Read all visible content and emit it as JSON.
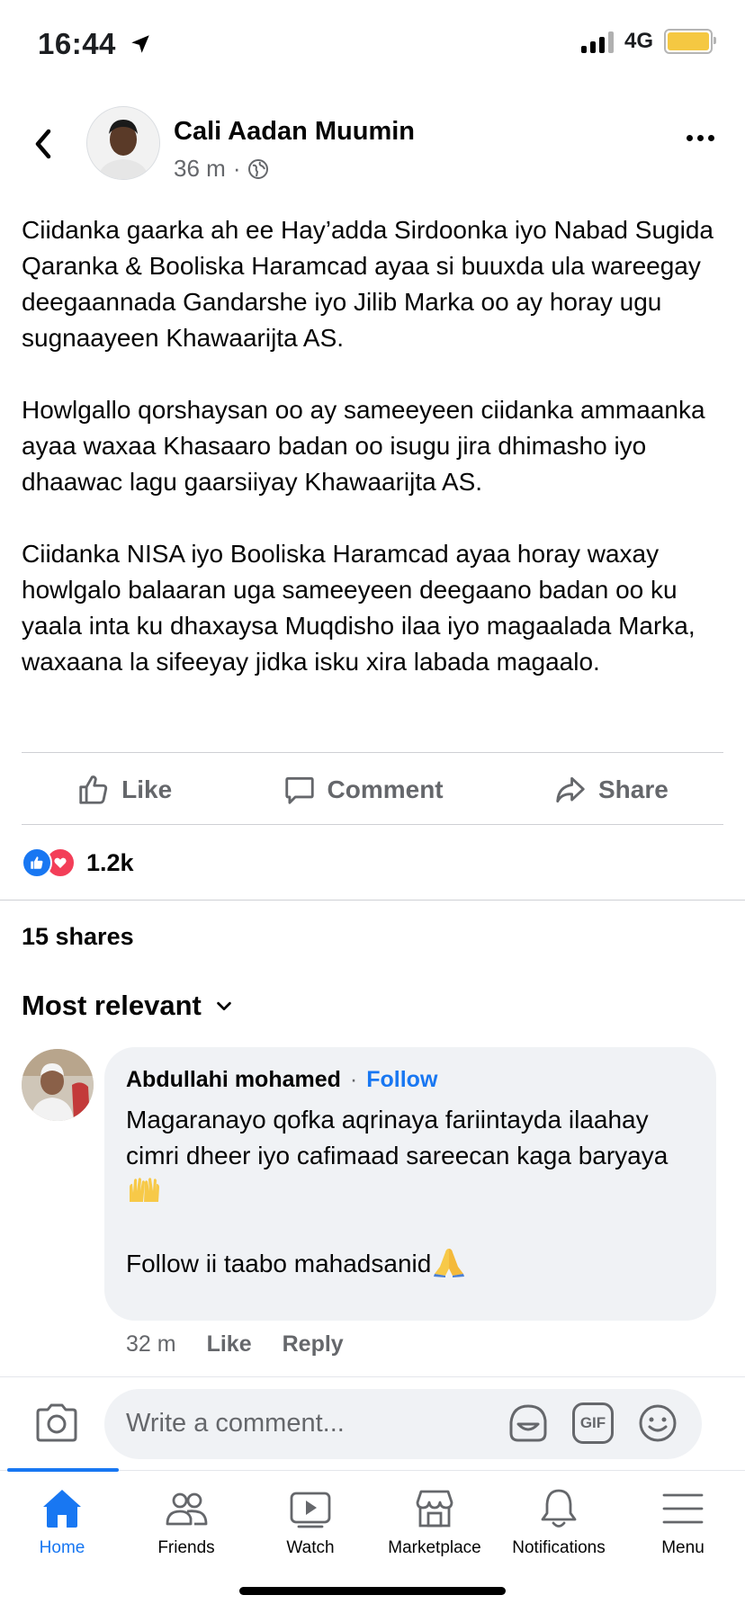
{
  "status_bar": {
    "time": "16:44",
    "network": "4G",
    "battery_color": "#f5c842",
    "icons": [
      "location-arrow-icon",
      "signal-icon",
      "battery-icon"
    ]
  },
  "post": {
    "author": "Cali Aadan Muumin",
    "time": "36 m",
    "separator": "·",
    "audience_icon": "globe-icon",
    "paragraphs": [
      "Ciidanka gaarka ah ee Hay’adda Sirdoonka iyo Nabad Sugida Qaranka & Booliska Haramcad ayaa si buuxda ula wareegay deegaannada Gandarshe iyo Jilib Marka oo ay horay ugu sugnaayeen Khawaarijta AS.",
      "Howlgallo qorshaysan oo ay sameeyeen ciidanka ammaanka ayaa waxaa Khasaaro badan oo isugu jira dhimasho iyo dhaawac lagu gaarsiiyay Khawaarijta AS.",
      "Ciidanka NISA iyo Booliska Haramcad ayaa horay waxay howlgalo balaaran uga sameeyeen deegaano badan oo ku yaala inta ku dhaxaysa Muqdisho ilaa iyo magaalada Marka, waxaana la sifeeyay jidka isku xira labada magaalo."
    ],
    "actions": {
      "like": "Like",
      "comment": "Comment",
      "share": "Share"
    },
    "reactions_count": "1.2k",
    "shares": "15 shares"
  },
  "comments": {
    "sort_label": "Most relevant",
    "items": [
      {
        "name": "Abdullahi mohamed",
        "separator": "·",
        "follow": "Follow",
        "line1": "Magaranayo qofka aqrinaya fariintayda ilaahay cimri dheer iyo cafimaad sareecan kaga baryaya",
        "line2": "Follow ii taabo mahadsanid",
        "time": "32 m",
        "like": "Like",
        "reply": "Reply"
      }
    ]
  },
  "composer": {
    "placeholder": "Write a comment...",
    "gif": "GIF"
  },
  "tabs": [
    {
      "label": "Home",
      "icon": "home-icon",
      "active": true
    },
    {
      "label": "Friends",
      "icon": "friends-icon"
    },
    {
      "label": "Watch",
      "icon": "watch-icon"
    },
    {
      "label": "Marketplace",
      "icon": "marketplace-icon"
    },
    {
      "label": "Notifications",
      "icon": "bell-icon"
    },
    {
      "label": "Menu",
      "icon": "menu-icon"
    }
  ],
  "colors": {
    "accent": "#1877f2",
    "text": "#050505",
    "secondary": "#65676b",
    "bubble": "#f0f2f5",
    "love": "#f33e58"
  }
}
